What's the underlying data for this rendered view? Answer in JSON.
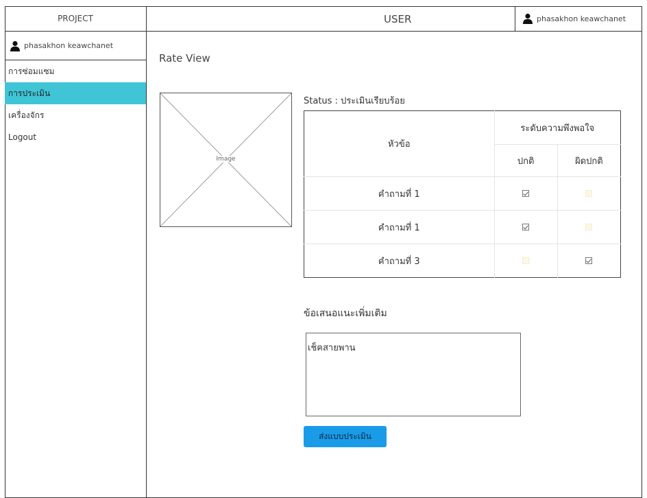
{
  "app": {
    "brand": "PROJECT",
    "header_title": "USER",
    "user_name": "phasakhon keawchanet"
  },
  "sidebar": {
    "user_name": "phasakhon keawchanet",
    "items": [
      {
        "label": "การซ่อมแซม",
        "active": false
      },
      {
        "label": "การประเมิน",
        "active": true
      },
      {
        "label": "เครื่องจักร",
        "active": false
      },
      {
        "label": "Logout",
        "active": false
      }
    ]
  },
  "main": {
    "page_title": "Rate View",
    "image_placeholder": "Image",
    "status": "Status : ประเมินเรียบร้อย",
    "table": {
      "topic_header": "หัวข้อ",
      "group_header": "ระดับความพึงพอใจ",
      "col_normal": "ปกติ",
      "col_abnormal": "ผิดปกติ",
      "rows": [
        {
          "question": "คำถามที่ 1",
          "normal": true,
          "abnormal": false
        },
        {
          "question": "คำถามที่ 1",
          "normal": true,
          "abnormal": false
        },
        {
          "question": "คำถามที่ 3",
          "normal": false,
          "abnormal": true
        }
      ]
    },
    "suggestion_label": "ข้อเสนอแนะเพิ่มเติม",
    "suggestion_value": "เช็คสายพาน",
    "submit_label": "ส่งแบบประเมิน"
  },
  "colors": {
    "active_nav": "#3fc5d6",
    "button": "#1a9be8",
    "unchecked_fill": "#fcf9e3"
  },
  "icons": {
    "user": "person-icon",
    "check": "check-icon"
  }
}
